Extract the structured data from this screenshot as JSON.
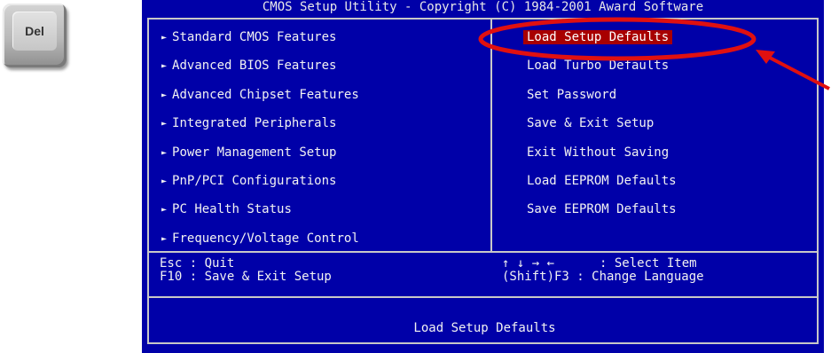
{
  "key": {
    "label": "Del"
  },
  "title": "CMOS Setup Utility - Copyright (C) 1984-2001 Award Software",
  "left_menu": [
    "Standard CMOS Features",
    "Advanced BIOS Features",
    "Advanced Chipset Features",
    "Integrated Peripherals",
    "Power Management Setup",
    "PnP/PCI Configurations",
    "PC Health Status",
    "Frequency/Voltage Control"
  ],
  "right_menu": [
    "Load Setup Defaults",
    "Load Turbo Defaults",
    "Set Password",
    "Save & Exit Setup",
    "Exit Without Saving",
    "Load EEPROM Defaults",
    "Save EEPROM Defaults"
  ],
  "selected_item": "Load Setup Defaults",
  "help": {
    "line1_left": "Esc : Quit",
    "line2_left": "F10 : Save & Exit Setup",
    "line1_keys": "↑ ↓ → ←",
    "line1_right": ": Select Item",
    "line2_right": "(Shift)F3 : Change Language"
  },
  "status_text": "Load Setup Defaults",
  "colors": {
    "bios_bg": "#0000a8",
    "selection": "#a80000",
    "annotation": "#e01010"
  }
}
